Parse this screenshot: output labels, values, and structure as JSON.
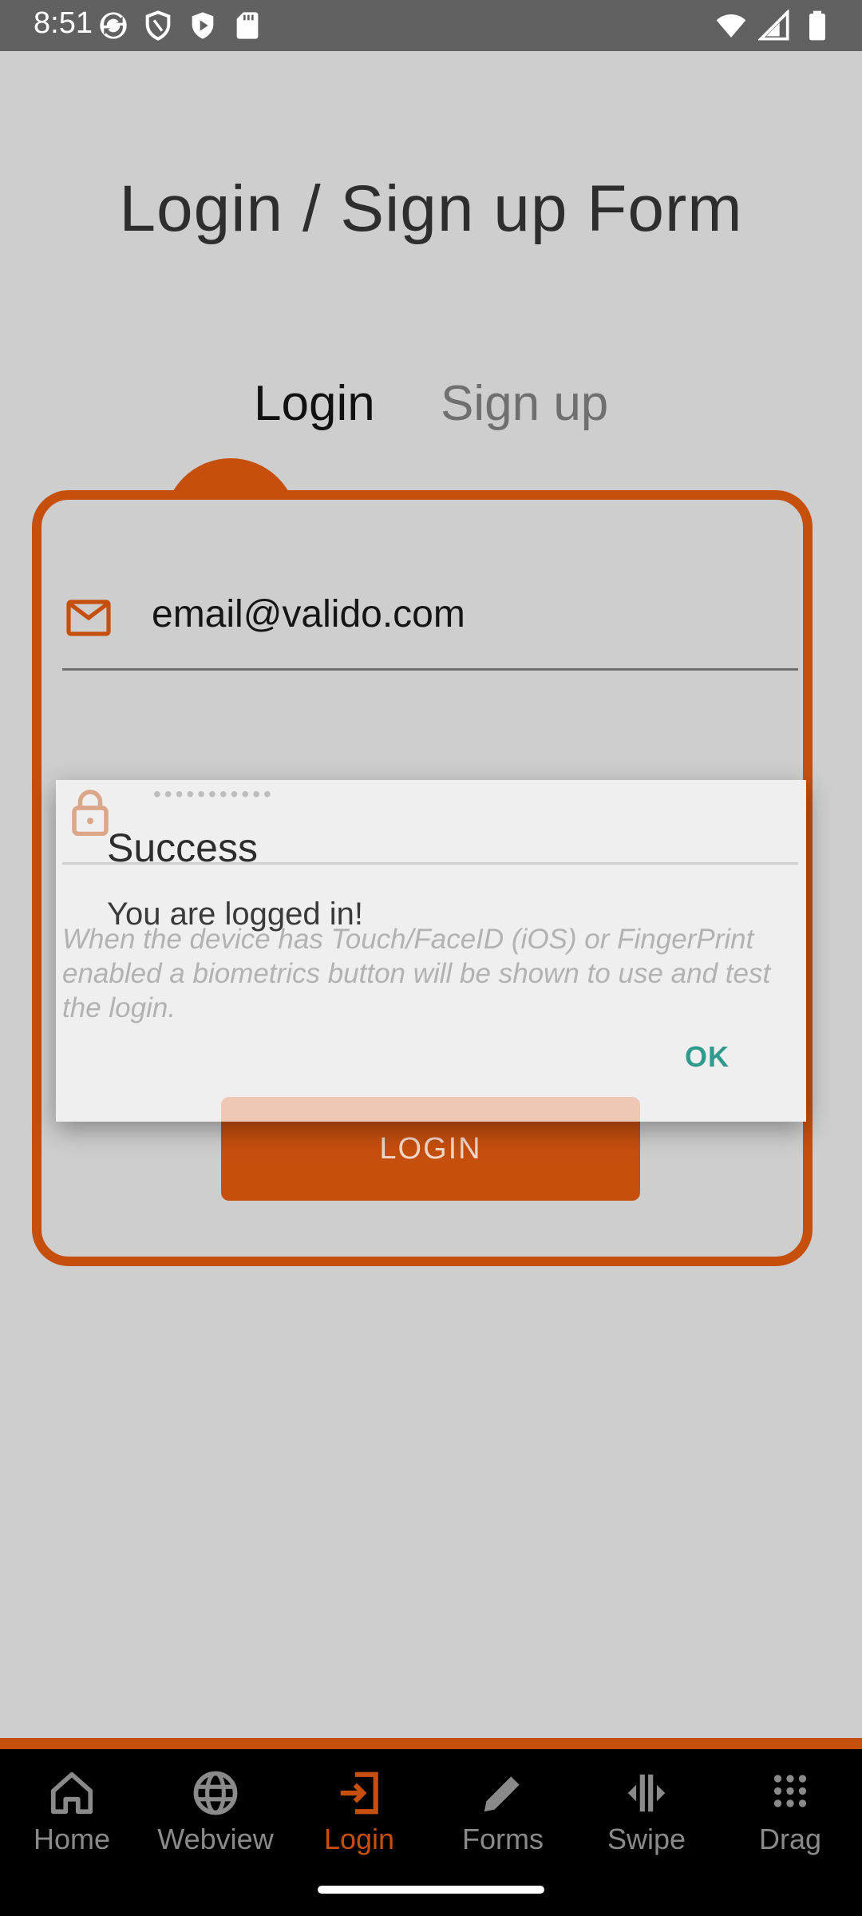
{
  "status_bar": {
    "time": "8:51"
  },
  "page": {
    "title": "Login / Sign up Form"
  },
  "tabs": [
    {
      "label": "Login",
      "active": true
    },
    {
      "label": "Sign up",
      "active": false
    }
  ],
  "form": {
    "email_value": "email@valido.com",
    "password_value": "•••••••••••",
    "hint": "When the device has Touch/FaceID (iOS) or FingerPrint enabled a biometrics button will be shown to use and test the login.",
    "login_button": "LOGIN"
  },
  "dialog": {
    "title": "Success",
    "message": "You are logged in!",
    "ok_label": "OK"
  },
  "bottom_nav": {
    "items": [
      {
        "label": "Home",
        "icon": "home-icon",
        "active": false
      },
      {
        "label": "Webview",
        "icon": "globe-icon",
        "active": false
      },
      {
        "label": "Login",
        "icon": "login-icon",
        "active": true
      },
      {
        "label": "Forms",
        "icon": "pencil-icon",
        "active": false
      },
      {
        "label": "Swipe",
        "icon": "swipe-icon",
        "active": false
      },
      {
        "label": "Drag",
        "icon": "grid-icon",
        "active": false
      }
    ]
  },
  "colors": {
    "accent": "#c64f0e",
    "dialog_button": "#2f9b8c",
    "background": "#cecece"
  }
}
